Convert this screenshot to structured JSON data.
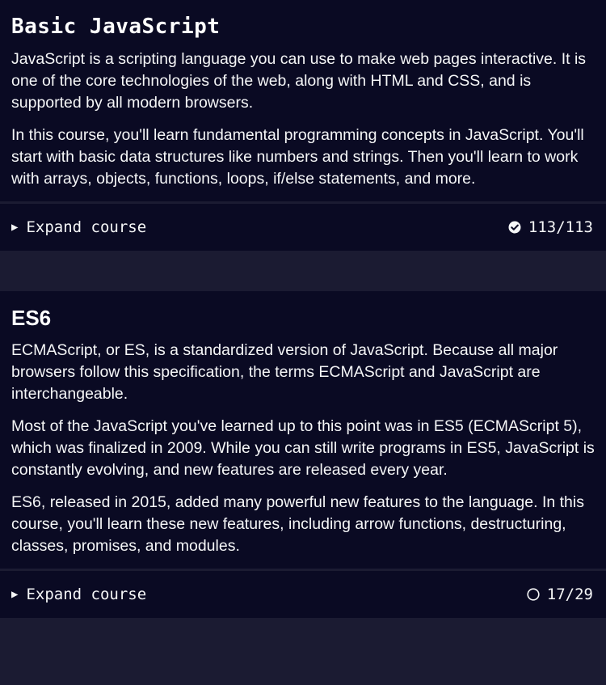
{
  "courses": [
    {
      "title": "Basic JavaScript",
      "paragraphs": [
        "JavaScript is a scripting language you can use to make web pages interactive. It is one of the core technologies of the web, along with HTML and CSS, and is supported by all modern browsers.",
        "In this course, you'll learn fundamental programming concepts in JavaScript. You'll start with basic data structures like numbers and strings. Then you'll learn to work with arrays, objects, functions, loops, if/else statements, and more."
      ],
      "expand_label": "Expand course",
      "expand_icon": "triangle-right-icon",
      "progress_icon": "check-circle-icon",
      "progress_text": "113/113",
      "completed": 113,
      "total": 113
    },
    {
      "title": "ES6",
      "paragraphs": [
        "ECMAScript, or ES, is a standardized version of JavaScript. Because all major browsers follow this specification, the terms ECMAScript and JavaScript are interchangeable.",
        "Most of the JavaScript you've learned up to this point was in ES5 (ECMAScript 5), which was finalized in 2009. While you can still write programs in ES5, JavaScript is constantly evolving, and new features are released every year.",
        "ES6, released in 2015, added many powerful new features to the language. In this course, you'll learn these new features, including arrow functions, destructuring, classes, promises, and modules."
      ],
      "expand_label": "Expand course",
      "expand_icon": "triangle-right-icon",
      "progress_icon": "empty-circle-icon",
      "progress_text": "17/29",
      "completed": 17,
      "total": 29
    }
  ]
}
